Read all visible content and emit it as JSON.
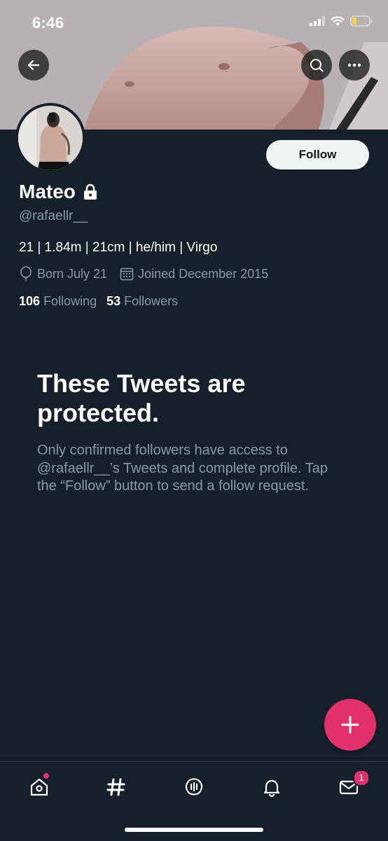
{
  "status_bar": {
    "time": "6:46"
  },
  "header": {
    "back_icon": "arrow-left-icon",
    "search_icon": "search-icon",
    "more_icon": "more-horizontal-icon"
  },
  "profile": {
    "follow_label": "Follow",
    "display_name": "Mateo",
    "lock_icon": "lock-icon",
    "handle": "@rafaellr__",
    "bio": "21 | 1.84m | 21cm | he/him | Virgo",
    "born": "Born July 21",
    "joined": "Joined December 2015",
    "following_count": "106",
    "following_label": "Following",
    "followers_count": "53",
    "followers_label": "Followers"
  },
  "protected": {
    "title": "These Tweets are protected.",
    "body": "Only confirmed followers have access to @rafaellr__’s Tweets and complete profile. Tap the “Follow” button to send a follow request."
  },
  "fab": {
    "icon": "plus-icon"
  },
  "bottom_nav": {
    "items": [
      {
        "name": "home",
        "icon": "home-icon"
      },
      {
        "name": "explore",
        "icon": "hashtag-icon"
      },
      {
        "name": "spaces",
        "icon": "spaces-icon"
      },
      {
        "name": "notifications",
        "icon": "bell-icon"
      },
      {
        "name": "messages",
        "icon": "envelope-icon"
      }
    ],
    "messages_badge": "1"
  },
  "colors": {
    "background": "#15202b",
    "accent": "#e1306c",
    "secondary_text": "#8b98a5"
  }
}
